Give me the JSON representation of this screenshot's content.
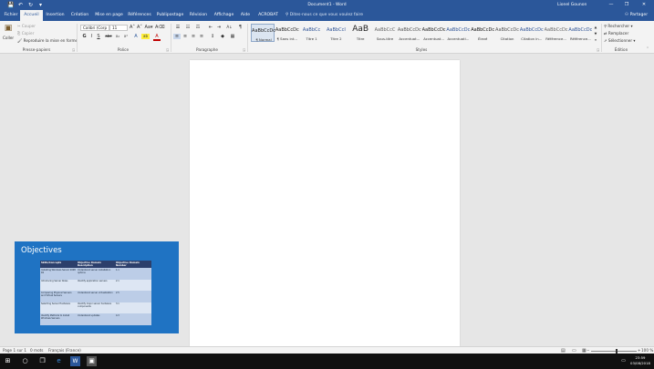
{
  "window": {
    "title": "Document1 - Word",
    "user": "Lionel Gounon",
    "controls": {
      "minimize": "—",
      "restore": "❐",
      "close": "✕"
    }
  },
  "quick_access": {
    "save": "💾",
    "undo": "↶",
    "redo": "↻",
    "customize": "▾"
  },
  "tabs": [
    {
      "label": "Fichier",
      "active": false
    },
    {
      "label": "Accueil",
      "active": true
    },
    {
      "label": "Insertion",
      "active": false
    },
    {
      "label": "Création",
      "active": false
    },
    {
      "label": "Mise en page",
      "active": false
    },
    {
      "label": "Références",
      "active": false
    },
    {
      "label": "Publipostage",
      "active": false
    },
    {
      "label": "Révision",
      "active": false
    },
    {
      "label": "Affichage",
      "active": false
    },
    {
      "label": "Aide",
      "active": false
    },
    {
      "label": "ACROBAT",
      "active": false
    }
  ],
  "tell_me": {
    "icon": "lightbulb-icon",
    "placeholder": "Dites-nous ce que vous voulez faire"
  },
  "share": {
    "label": "Partager",
    "icon": "person-icon"
  },
  "clipboard": {
    "paste_label": "Coller",
    "cut_label": "Couper",
    "copy_label": "Copier",
    "format_painter_label": "Reproduire la mise en forme",
    "group_label": "Presse-papiers"
  },
  "font": {
    "name": "Calibri (Corp",
    "size": "11",
    "group_label": "Police",
    "buttons": {
      "grow": "A˄",
      "shrink": "A˅",
      "case": "Aa▾",
      "clear": "A⌫",
      "bold": "G",
      "italic": "I",
      "underline": "S",
      "strike": "abc",
      "subscript": "x₂",
      "superscript": "x²",
      "effects": "A",
      "highlight": "ab",
      "color": "A"
    }
  },
  "paragraph": {
    "group_label": "Paragraphe",
    "buttons": {
      "bullets": "☰",
      "numbering": "☷",
      "multilevel": "☶",
      "outdent": "⇤",
      "indent": "⇥",
      "sort": "A↓",
      "pilcrow": "¶",
      "align_left": "≡",
      "align_center": "≡",
      "align_right": "≡",
      "justify": "≡",
      "line_spacing": "↕",
      "shading": "◆",
      "borders": "▦"
    }
  },
  "styles": {
    "group_label": "Styles",
    "items": [
      {
        "preview": "AaBbCcDc",
        "name": "¶ Normal",
        "active": true,
        "color": "#222222",
        "big": false
      },
      {
        "preview": "AaBbCcDc",
        "name": "¶ Sans int...",
        "active": false,
        "color": "#222222",
        "big": false
      },
      {
        "preview": "AaBbCc",
        "name": "Titre 1",
        "active": false,
        "color": "#2f5496",
        "big": false
      },
      {
        "preview": "AaBbCcI",
        "name": "Titre 2",
        "active": false,
        "color": "#2f5496",
        "big": false
      },
      {
        "preview": "AaB",
        "name": "Titre",
        "active": false,
        "color": "#222222",
        "big": true
      },
      {
        "preview": "AaBbCcC",
        "name": "Sous-titre",
        "active": false,
        "color": "#666666",
        "big": false
      },
      {
        "preview": "AaBbCcDc",
        "name": "Accentuat...",
        "active": false,
        "color": "#555555",
        "big": false
      },
      {
        "preview": "AaBbCcDc",
        "name": "Accentuat...",
        "active": false,
        "color": "#222222",
        "big": false
      },
      {
        "preview": "AaBbCcDc",
        "name": "Accentuati...",
        "active": false,
        "color": "#2f5496",
        "big": false
      },
      {
        "preview": "AaBbCcDc",
        "name": "Élevé",
        "active": false,
        "color": "#111111",
        "big": false
      },
      {
        "preview": "AaBbCcDc",
        "name": "Citation",
        "active": false,
        "color": "#555555",
        "big": false
      },
      {
        "preview": "AaBbCcDc",
        "name": "Citation in...",
        "active": false,
        "color": "#2f5496",
        "big": false
      },
      {
        "preview": "AaBbCcDc",
        "name": "Référence...",
        "active": false,
        "color": "#666666",
        "big": false
      },
      {
        "preview": "AaBbCcDc",
        "name": "Référence...",
        "active": false,
        "color": "#2f5496",
        "big": false
      }
    ]
  },
  "editing": {
    "group_label": "Édition",
    "find_label": "Rechercher",
    "replace_label": "Remplacer",
    "select_label": "Sélectionner"
  },
  "slide": {
    "title": "Objectives",
    "headers": [
      "Skills/Concepts",
      "Objective Domain Description",
      "Objective Domain Number"
    ],
    "rows": [
      [
        "Installing Windows Server 2008 R2",
        "Understand server installation options",
        "1.1"
      ],
      [
        "Introducing Server Roles",
        "Identify application servers",
        "2.1"
      ],
      [
        "Comparing Physical Servers and Virtual Servers",
        "Understand server virtualization",
        "2.5"
      ],
      [
        "Selecting Server Hardware",
        "Identify major server hardware components",
        "3.1"
      ],
      [
        "Identify Methods to Install Windows Servers",
        "Understand updates",
        "4.3"
      ]
    ]
  },
  "status": {
    "page": "Page 1 sur 1",
    "words": "0 mots",
    "language": "Français (France)",
    "zoom": "100 %",
    "zoom_fraction": 0.56
  },
  "taskbar": {
    "time": "23:59",
    "date": "03/08/2018"
  }
}
